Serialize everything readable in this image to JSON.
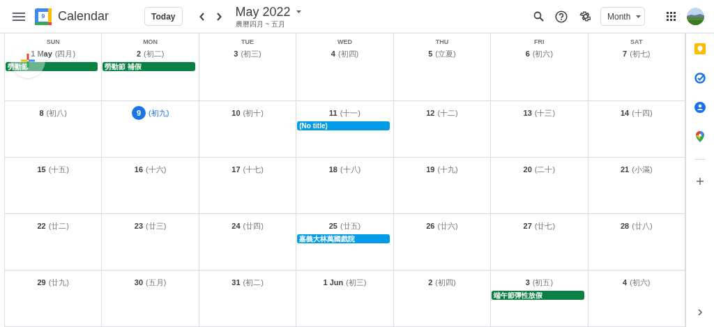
{
  "header": {
    "app_name": "Calendar",
    "logo_number": "9",
    "today_button": "Today",
    "title": "May 2022",
    "subtitle": "農曆四月 ~ 五月",
    "view_selector": "Month"
  },
  "weekdays": [
    "SUN",
    "MON",
    "TUE",
    "WED",
    "THU",
    "FRI",
    "SAT"
  ],
  "weeks": [
    {
      "days": [
        {
          "day": "1 May",
          "lunar": "(四月)",
          "today": false,
          "events": [
            {
              "title": "勞動節",
              "color": "#0b8043"
            }
          ]
        },
        {
          "day": "2",
          "lunar": "(初二)",
          "today": false,
          "events": [
            {
              "title": "勞動節 補假",
              "color": "#0b8043"
            }
          ]
        },
        {
          "day": "3",
          "lunar": "(初三)",
          "today": false
        },
        {
          "day": "4",
          "lunar": "(初四)",
          "today": false
        },
        {
          "day": "5",
          "lunar": "(立夏)",
          "today": false
        },
        {
          "day": "6",
          "lunar": "(初六)",
          "today": false
        },
        {
          "day": "7",
          "lunar": "(初七)",
          "today": false
        }
      ]
    },
    {
      "days": [
        {
          "day": "8",
          "lunar": "(初八)",
          "today": false
        },
        {
          "day": "9",
          "lunar": "(初九)",
          "today": true
        },
        {
          "day": "10",
          "lunar": "(初十)",
          "today": false
        },
        {
          "day": "11",
          "lunar": "(十一)",
          "today": false,
          "events": [
            {
              "title": "(No title)",
              "color": "#039be5"
            }
          ]
        },
        {
          "day": "12",
          "lunar": "(十二)",
          "today": false
        },
        {
          "day": "13",
          "lunar": "(十三)",
          "today": false
        },
        {
          "day": "14",
          "lunar": "(十四)",
          "today": false
        }
      ]
    },
    {
      "days": [
        {
          "day": "15",
          "lunar": "(十五)",
          "today": false
        },
        {
          "day": "16",
          "lunar": "(十六)",
          "today": false
        },
        {
          "day": "17",
          "lunar": "(十七)",
          "today": false
        },
        {
          "day": "18",
          "lunar": "(十八)",
          "today": false
        },
        {
          "day": "19",
          "lunar": "(十九)",
          "today": false
        },
        {
          "day": "20",
          "lunar": "(二十)",
          "today": false
        },
        {
          "day": "21",
          "lunar": "(小滿)",
          "today": false
        }
      ]
    },
    {
      "days": [
        {
          "day": "22",
          "lunar": "(廿二)",
          "today": false
        },
        {
          "day": "23",
          "lunar": "(廿三)",
          "today": false
        },
        {
          "day": "24",
          "lunar": "(廿四)",
          "today": false
        },
        {
          "day": "25",
          "lunar": "(廿五)",
          "today": false,
          "events": [
            {
              "title": "嘉義大林萬國戲院",
              "color": "#039be5"
            }
          ]
        },
        {
          "day": "26",
          "lunar": "(廿六)",
          "today": false
        },
        {
          "day": "27",
          "lunar": "(廿七)",
          "today": false
        },
        {
          "day": "28",
          "lunar": "(廿八)",
          "today": false
        }
      ]
    },
    {
      "days": [
        {
          "day": "29",
          "lunar": "(廿九)",
          "today": false
        },
        {
          "day": "30",
          "lunar": "(五月)",
          "today": false
        },
        {
          "day": "31",
          "lunar": "(初二)",
          "today": false
        },
        {
          "day": "1 Jun",
          "lunar": "(初三)",
          "today": false
        },
        {
          "day": "2",
          "lunar": "(初四)",
          "today": false
        },
        {
          "day": "3",
          "lunar": "(初五)",
          "today": false,
          "events": [
            {
              "title": "端午節彈性放假",
              "color": "#0b8043"
            }
          ]
        },
        {
          "day": "4",
          "lunar": "(初六)",
          "today": false
        }
      ]
    }
  ]
}
